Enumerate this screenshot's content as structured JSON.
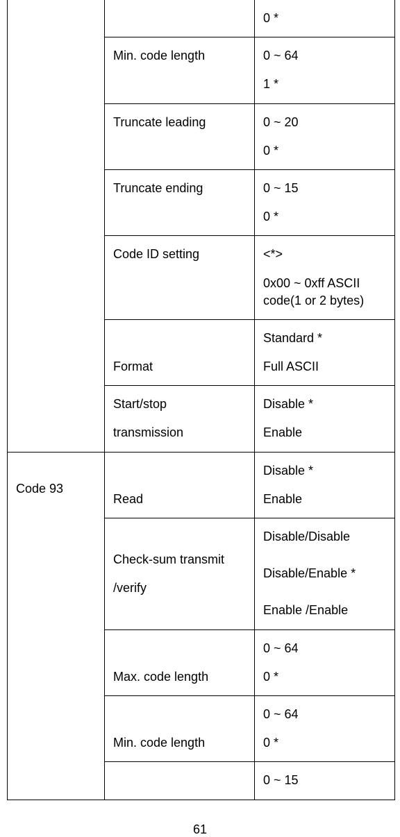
{
  "section1": {
    "groupLabel": "",
    "rows": [
      {
        "param": "",
        "vals": [
          "0 *"
        ]
      },
      {
        "param": "Min. code length",
        "vals": [
          "0 ~ 64",
          "1 *"
        ]
      },
      {
        "param": "Truncate leading",
        "vals": [
          "0 ~ 20",
          "0 *"
        ]
      },
      {
        "param": "Truncate ending",
        "vals": [
          "0 ~ 15",
          "0 *"
        ]
      },
      {
        "param": "Code ID setting",
        "vals": [
          "<*>",
          "0x00 ~ 0xff ASCII code(1 or 2 bytes)"
        ]
      },
      {
        "param": "Format",
        "vals": [
          "Standard *",
          "Full ASCII"
        ]
      },
      {
        "param": "Start/stop transmission",
        "vals": [
          "Disable *",
          "Enable"
        ]
      }
    ]
  },
  "section2": {
    "groupLabel": "Code 93",
    "rows": [
      {
        "param": "Read",
        "vals": [
          "Disable *",
          "Enable"
        ]
      },
      {
        "param": "Check-sum transmit /verify",
        "vals": [
          "Disable/Disable",
          "Disable/Enable *",
          "Enable /Enable"
        ]
      },
      {
        "param": "Max. code length",
        "vals": [
          "0 ~ 64",
          "0 *"
        ]
      },
      {
        "param": "Min. code length",
        "vals": [
          "0 ~ 64",
          "0 *"
        ]
      },
      {
        "param": "",
        "vals": [
          "0 ~ 15"
        ]
      }
    ]
  },
  "pageNumber": "61"
}
